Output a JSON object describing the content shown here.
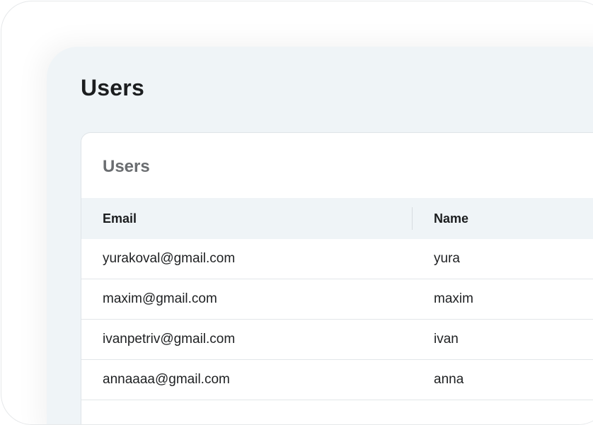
{
  "page": {
    "title": "Users"
  },
  "card": {
    "title": "Users"
  },
  "table": {
    "columns": [
      {
        "label": "Email"
      },
      {
        "label": "Name"
      }
    ],
    "rows": [
      {
        "email": "yurakoval@gmail.com",
        "name": "yura"
      },
      {
        "email": "maxim@gmail.com",
        "name": "maxim"
      },
      {
        "email": "ivanpetriv@gmail.com",
        "name": "ivan"
      },
      {
        "email": "annaaaa@gmail.com",
        "name": "anna"
      }
    ]
  }
}
